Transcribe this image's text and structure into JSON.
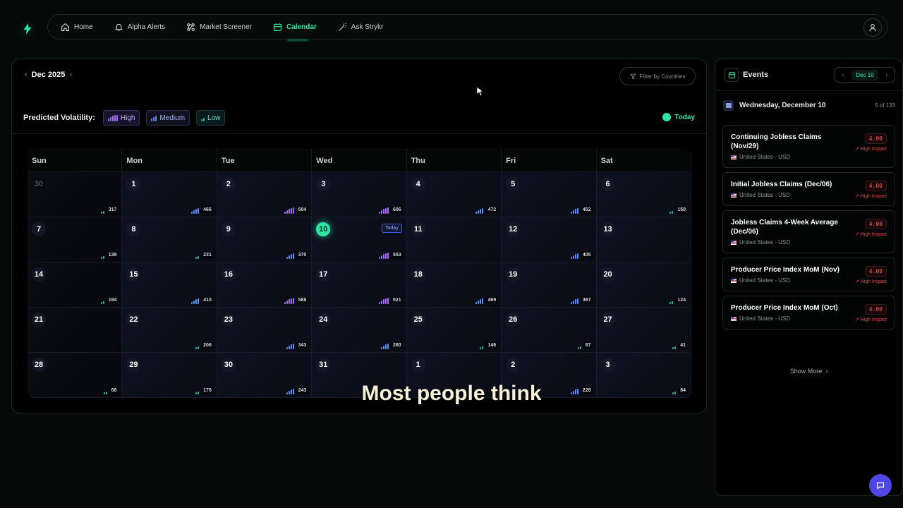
{
  "nav": {
    "items": [
      {
        "label": "Home",
        "icon": "home-icon",
        "active": false
      },
      {
        "label": "Alpha Alerts",
        "icon": "bell-icon",
        "active": false
      },
      {
        "label": "Market Screener",
        "icon": "screener-icon",
        "active": false
      },
      {
        "label": "Calendar",
        "icon": "calendar-icon",
        "active": true
      },
      {
        "label": "Ask Strykr",
        "icon": "wand-icon",
        "active": false
      }
    ]
  },
  "calendar": {
    "month": "Dec 2025",
    "filter_label": "Filter by Countries",
    "volatility_title": "Predicted Volatility:",
    "volatility": {
      "high": "High",
      "medium": "Medium",
      "low": "Low"
    },
    "today_label": "Today",
    "weekdays": [
      "Sun",
      "Mon",
      "Tue",
      "Wed",
      "Thu",
      "Fri",
      "Sat"
    ],
    "days": [
      {
        "n": "30",
        "c": "317",
        "lvl": "low",
        "muted": true
      },
      {
        "n": "1",
        "c": "466",
        "lvl": "med"
      },
      {
        "n": "2",
        "c": "504",
        "lvl": "high"
      },
      {
        "n": "3",
        "c": "606",
        "lvl": "high"
      },
      {
        "n": "4",
        "c": "472",
        "lvl": "med"
      },
      {
        "n": "5",
        "c": "452",
        "lvl": "med"
      },
      {
        "n": "6",
        "c": "150",
        "lvl": "low"
      },
      {
        "n": "7",
        "c": "139",
        "lvl": "low"
      },
      {
        "n": "8",
        "c": "231",
        "lvl": "low"
      },
      {
        "n": "9",
        "c": "370",
        "lvl": "med"
      },
      {
        "n": "10",
        "c": "553",
        "lvl": "high",
        "today": true
      },
      {
        "n": "11",
        "c": "",
        "lvl": ""
      },
      {
        "n": "12",
        "c": "405",
        "lvl": "med"
      },
      {
        "n": "13",
        "c": "",
        "lvl": ""
      },
      {
        "n": "14",
        "c": "194",
        "lvl": "low"
      },
      {
        "n": "15",
        "c": "410",
        "lvl": "med"
      },
      {
        "n": "16",
        "c": "588",
        "lvl": "high"
      },
      {
        "n": "17",
        "c": "521",
        "lvl": "high"
      },
      {
        "n": "18",
        "c": "469",
        "lvl": "med"
      },
      {
        "n": "19",
        "c": "367",
        "lvl": "med"
      },
      {
        "n": "20",
        "c": "124",
        "lvl": "low"
      },
      {
        "n": "21",
        "c": "",
        "lvl": ""
      },
      {
        "n": "22",
        "c": "206",
        "lvl": "low"
      },
      {
        "n": "23",
        "c": "343",
        "lvl": "med"
      },
      {
        "n": "24",
        "c": "280",
        "lvl": "med"
      },
      {
        "n": "25",
        "c": "146",
        "lvl": "low"
      },
      {
        "n": "26",
        "c": "87",
        "lvl": "low"
      },
      {
        "n": "27",
        "c": "41",
        "lvl": "low"
      },
      {
        "n": "28",
        "c": "68",
        "lvl": "low"
      },
      {
        "n": "29",
        "c": "176",
        "lvl": "low"
      },
      {
        "n": "30",
        "c": "243",
        "lvl": "med"
      },
      {
        "n": "31",
        "c": "",
        "lvl": ""
      },
      {
        "n": "1",
        "c": "",
        "lvl": ""
      },
      {
        "n": "2",
        "c": "228",
        "lvl": "med"
      },
      {
        "n": "3",
        "c": "84",
        "lvl": "low"
      }
    ]
  },
  "events": {
    "title": "Events",
    "date_switch": "Dec 10",
    "date_label": "Wednesday, December 10",
    "count_label": "5 of 133",
    "items": [
      {
        "name": "Continuing Jobless Claims (Nov/29)",
        "country": "United States - USD",
        "value": "4.00",
        "impact": "High Impact"
      },
      {
        "name": "Initial Jobless Claims (Dec/06)",
        "country": "United States - USD",
        "value": "4.00",
        "impact": "High Impact"
      },
      {
        "name": "Jobless Claims 4-Week Average (Dec/06)",
        "country": "United States - USD",
        "value": "4.00",
        "impact": "High Impact"
      },
      {
        "name": "Producer Price Index MoM (Nov)",
        "country": "United States - USD",
        "value": "4.00",
        "impact": "High Impact"
      },
      {
        "name": "Producer Price Index MoM (Oct)",
        "country": "United States - USD",
        "value": "4.00",
        "impact": "High Impact"
      }
    ],
    "show_more": "Show More"
  },
  "caption": "Most people think",
  "colors": {
    "accent": "#2ee6a8",
    "high": "#a66bff",
    "medium": "#5b8cff",
    "low": "#2bb39a",
    "impact": "#ff5c5c"
  }
}
